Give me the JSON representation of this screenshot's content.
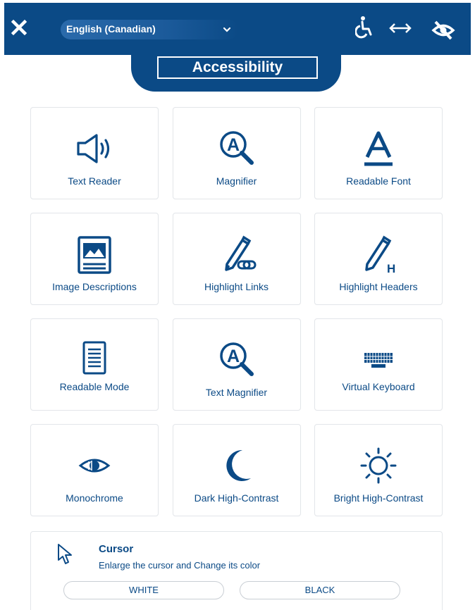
{
  "header": {
    "language": "English (Canadian)",
    "title": "Accessibility"
  },
  "icons": {
    "close": "close-icon",
    "accessibility": "wheelchair-icon",
    "width": "horizontal-arrows-icon",
    "hide": "eye-slash-icon"
  },
  "features": [
    {
      "label": "Text Reader",
      "icon": "speaker-icon"
    },
    {
      "label": "Magnifier",
      "icon": "magnifier-icon"
    },
    {
      "label": "Readable Font",
      "icon": "letter-a-icon"
    },
    {
      "label": "Image Descriptions",
      "icon": "image-icon"
    },
    {
      "label": "Highlight Links",
      "icon": "pen-link-icon"
    },
    {
      "label": "Highlight Headers",
      "icon": "pen-heading-icon"
    },
    {
      "label": "Readable Mode",
      "icon": "document-icon"
    },
    {
      "label": "Text Magnifier",
      "icon": "text-magnifier-icon"
    },
    {
      "label": "Virtual Keyboard",
      "icon": "keyboard-icon"
    },
    {
      "label": "Monochrome",
      "icon": "eye-icon"
    },
    {
      "label": "Dark High-Contrast",
      "icon": "moon-icon"
    },
    {
      "label": "Bright High-Contrast",
      "icon": "sun-icon"
    }
  ],
  "cursor": {
    "title": "Cursor",
    "description": "Enlarge the cursor and Change its color",
    "white_label": "WHITE",
    "black_label": "BLACK"
  },
  "colors": {
    "primary": "#0b4a86",
    "tile_border": "#e3e6ea",
    "background": "#ffffff"
  }
}
